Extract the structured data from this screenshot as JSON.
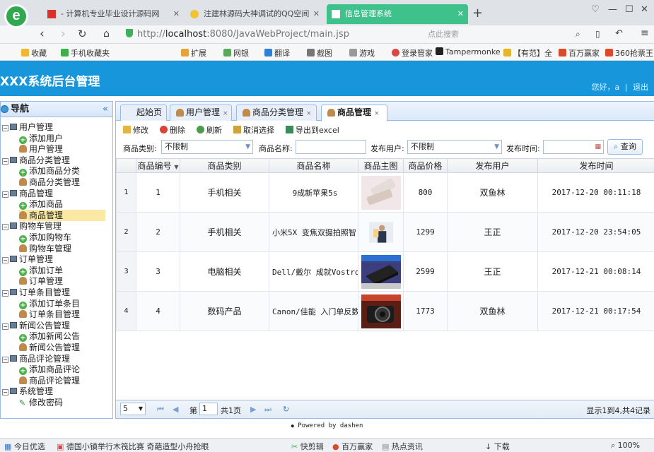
{
  "browser": {
    "logo_letter": "e",
    "tabs": [
      {
        "title": "- 计算机专业毕业设计源码网",
        "close": "✕"
      },
      {
        "title": "注建林源码大神调试的QQ空间",
        "close": "✕"
      },
      {
        "title": "信息管理系统",
        "close": "✕"
      }
    ],
    "new_tab": "+",
    "address_prefix": "http://",
    "address_host": "localhost",
    "address_rest": ":8080/JavaWebProject/main.jsp",
    "search_placeholder": "点此搜索",
    "bookmarks": [
      "收藏",
      "手机收藏夹",
      "扩展",
      "网银",
      "翻译",
      "截图",
      "游戏",
      "登录管家",
      "Tampermonke",
      "【有范】全",
      "百万赢家",
      "360抢票王"
    ]
  },
  "app": {
    "title": "XXX系统后台管理",
    "greeting": "您好，",
    "user_name": "a",
    "separator": "|",
    "logout": "退出"
  },
  "sidebar": {
    "title": "导航",
    "collapse": "«",
    "groups": [
      {
        "label": "用户管理",
        "items": [
          "添加用户",
          "用户管理"
        ]
      },
      {
        "label": "商品分类管理",
        "items": [
          "添加商品分类",
          "商品分类管理"
        ]
      },
      {
        "label": "商品管理",
        "items": [
          "添加商品",
          "商品管理"
        ]
      },
      {
        "label": "购物车管理",
        "items": [
          "添加购物车",
          "购物车管理"
        ]
      },
      {
        "label": "订单管理",
        "items": [
          "添加订单",
          "订单管理"
        ]
      },
      {
        "label": "订单条目管理",
        "items": [
          "添加订单条目",
          "订单条目管理"
        ]
      },
      {
        "label": "新闻公告管理",
        "items": [
          "添加新闻公告",
          "新闻公告管理"
        ]
      },
      {
        "label": "商品评论管理",
        "items": [
          "添加商品评论",
          "商品评论管理"
        ]
      },
      {
        "label": "系统管理",
        "items": [
          "修改密码"
        ]
      }
    ]
  },
  "main": {
    "tabs": [
      {
        "label": "起始页"
      },
      {
        "label": "用户管理",
        "close": "×"
      },
      {
        "label": "商品分类管理",
        "close": "×"
      },
      {
        "label": "商品管理",
        "close": "×"
      }
    ],
    "toolbar": {
      "edit": "修改",
      "delete": "删除",
      "refresh": "刷新",
      "cancel_select": "取消选择",
      "export": "导出到excel"
    },
    "filters": {
      "category_label": "商品类别:",
      "category_value": "不限制",
      "name_label": "商品名称:",
      "name_value": "",
      "publisher_label": "发布用户:",
      "publisher_value": "不限制",
      "time_label": "发布时间:",
      "time_value": "",
      "query": "查询"
    },
    "grid": {
      "columns": [
        "商品编号",
        "商品类别",
        "商品名称",
        "商品主图",
        "商品价格",
        "发布用户",
        "发布时间"
      ],
      "rows": [
        {
          "rownum": "1",
          "id": "1",
          "category": "手机相关",
          "name": "9成新苹果5s",
          "price": "800",
          "user": "双鱼林",
          "time": "2017-12-20 00:11:18"
        },
        {
          "rownum": "2",
          "id": "2",
          "category": "手机相关",
          "name": "小米5X 变焦双摄拍照智",
          "price": "1299",
          "user": "王正",
          "time": "2017-12-20 23:54:05"
        },
        {
          "rownum": "3",
          "id": "3",
          "category": "电脑相关",
          "name": "Dell/戴尔 成就Vostro",
          "price": "2599",
          "user": "王正",
          "time": "2017-12-21 00:08:14"
        },
        {
          "rownum": "4",
          "id": "4",
          "category": "数码产品",
          "name": "Canon/佳能 入门单反数",
          "price": "1773",
          "user": "双鱼林",
          "time": "2017-12-21 00:17:54"
        }
      ]
    },
    "pager": {
      "page_size": "5",
      "page_prefix": "第",
      "page_value": "1",
      "page_suffix": "共1页",
      "summary": "显示1到4,共4记录"
    }
  },
  "footer": "Powered by dashen",
  "statusbar": {
    "left": "今日优选",
    "news": "德国小镇举行木筏比赛 奇葩造型小舟抢眼",
    "items": [
      "快剪辑",
      "百万赢家",
      "热点资讯",
      "下载",
      "100%"
    ]
  }
}
